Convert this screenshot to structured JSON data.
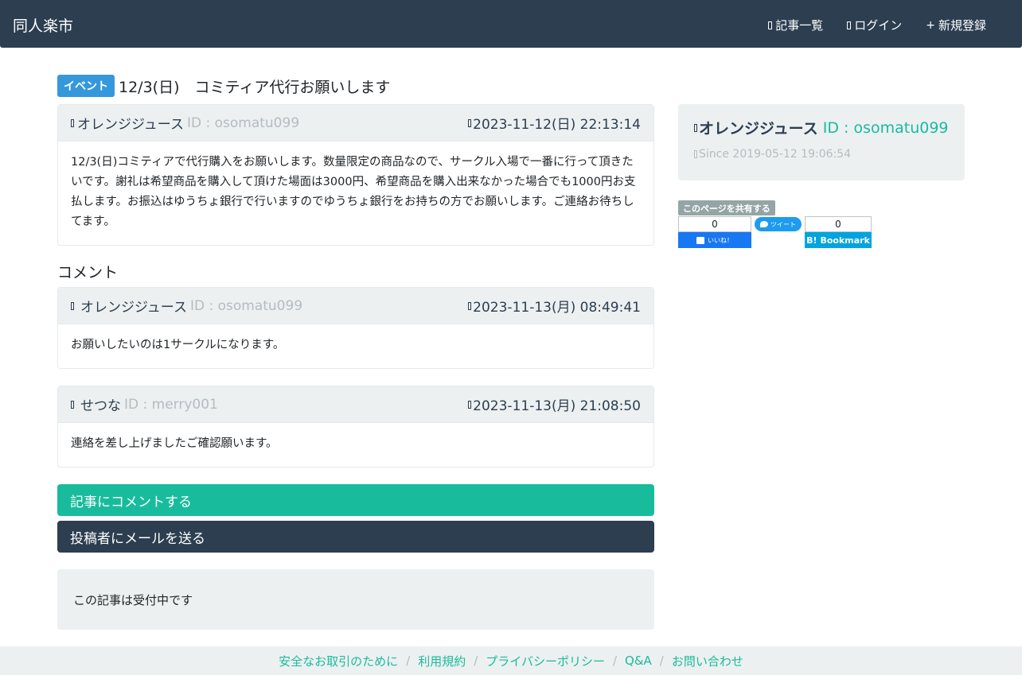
{
  "nav": {
    "brand": "同人楽市",
    "links": [
      {
        "label": "記事一覧",
        "icon": "list-icon"
      },
      {
        "label": "ログイン",
        "icon": "login-icon"
      },
      {
        "label": "新規登録",
        "icon": "plus-icon"
      }
    ]
  },
  "post": {
    "badge": "イベント",
    "title": "12/3(日)　コミティア代行お願いします",
    "author": "オレンジジュース",
    "author_id": "ID : osomatu099",
    "date": "2023-11-12(日) 22:13:14",
    "body": "12/3(日)コミティアで代行購入をお願いします。数量限定の商品なので、サークル入場で一番に行って頂きたいです。謝礼は希望商品を購入して頂けた場面は3000円、希望商品を購入出来なかった場合でも1000円お支払します。お振込はゆうちょ銀行で行いますのでゆうちょ銀行をお持ちの方でお願いします。ご連絡お待ちしてます。"
  },
  "comments_section": {
    "title": "コメント",
    "comments": [
      {
        "author": "オレンジジュース",
        "author_id": "ID : osomatu099",
        "date": "2023-11-13(月) 08:49:41",
        "body": "お願いしたいのは1サークルになります。"
      },
      {
        "author": "せつな",
        "author_id": "ID : merry001",
        "date": "2023-11-13(月) 21:08:50",
        "body": "連絡を差し上げましたご確認願います。"
      }
    ]
  },
  "actions": {
    "comment_label": "記事にコメントする",
    "mail_label": "投稿者にメールを送る"
  },
  "status": {
    "text": "この記事は受付中です"
  },
  "sidebar": {
    "user": "オレンジジュース",
    "user_id": "ID : osomatu099",
    "since": "Since 2019-05-12 19:06:54"
  },
  "share": {
    "label": "このページを共有する",
    "fb_count": "0",
    "fb_button": "いいね！",
    "tw_button": "ツイート",
    "hb_count": "0",
    "hb_button": "Bookmark"
  },
  "footer": {
    "links": [
      "安全なお取引のために",
      "利用規約",
      "プライバシーポリシー",
      "Q&A",
      "お問い合わせ"
    ],
    "separator": "/"
  },
  "colors": {
    "navbar": "#2c3e50",
    "accent": "#18bc9c",
    "badge": "#3498db",
    "panel": "#ecf0f1",
    "muted": "#b4bcc2"
  }
}
